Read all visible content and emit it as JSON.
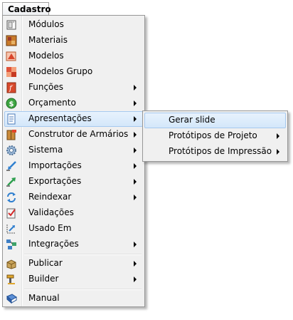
{
  "menubar": {
    "label": "Cadastro"
  },
  "menu": {
    "items": [
      {
        "label": "Módulos",
        "icon": "modules-icon"
      },
      {
        "label": "Materiais",
        "icon": "materials-icon"
      },
      {
        "label": "Modelos",
        "icon": "models-icon"
      },
      {
        "label": "Modelos Grupo",
        "icon": "model-group-icon"
      },
      {
        "label": "Funções",
        "icon": "functions-icon"
      },
      {
        "label": "Orçamento",
        "icon": "budget-icon"
      },
      {
        "label": "Apresentações",
        "icon": "presentation-icon"
      },
      {
        "label": "Construtor de Armários",
        "icon": "cabinet-builder-icon"
      },
      {
        "label": "Sistema",
        "icon": "gear-icon"
      },
      {
        "label": "Importações",
        "icon": "import-icon"
      },
      {
        "label": "Exportações",
        "icon": "export-icon"
      },
      {
        "label": "Reindexar",
        "icon": "reindex-icon"
      },
      {
        "label": "Validações",
        "icon": "validation-icon"
      },
      {
        "label": "Usado Em",
        "icon": "used-in-icon"
      },
      {
        "label": "Integrações",
        "icon": "integration-icon"
      },
      {
        "label": "Publicar",
        "icon": "publish-icon"
      },
      {
        "label": "Builder",
        "icon": "builder-icon"
      },
      {
        "label": "Manual",
        "icon": "manual-icon"
      }
    ]
  },
  "submenu": {
    "items": [
      {
        "label": "Gerar slide"
      },
      {
        "label": "Protótipos de Projeto"
      },
      {
        "label": "Protótipos de Impressão"
      }
    ]
  },
  "colors": {
    "highlight_border": "#a6c9ef",
    "highlight_fill": "#d4e7fa",
    "menu_bg": "#f0f0f0"
  }
}
